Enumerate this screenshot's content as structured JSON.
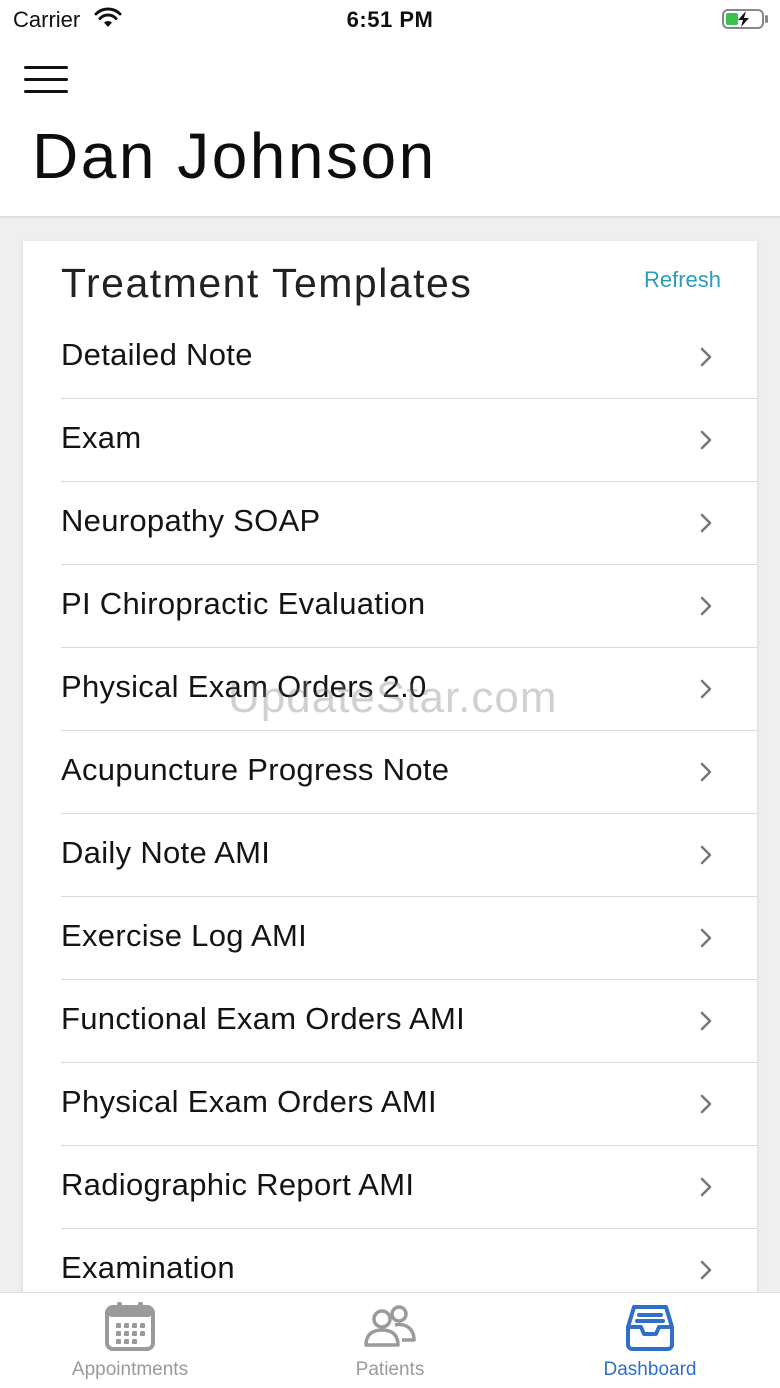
{
  "status_bar": {
    "carrier": "Carrier",
    "time": "6:51 PM"
  },
  "header": {
    "title": "Dan Johnson",
    "menu_icon": "hamburger-menu-icon"
  },
  "card": {
    "title": "Treatment Templates",
    "refresh_label": "Refresh",
    "accent_color": "#2a9dbb",
    "items": [
      {
        "label": "Detailed Note"
      },
      {
        "label": "Exam"
      },
      {
        "label": "Neuropathy SOAP"
      },
      {
        "label": "PI Chiropractic Evaluation"
      },
      {
        "label": "Physical Exam Orders 2.0"
      },
      {
        "label": "Acupuncture Progress Note"
      },
      {
        "label": "Daily Note AMI"
      },
      {
        "label": "Exercise Log AMI"
      },
      {
        "label": "Functional Exam Orders AMI"
      },
      {
        "label": "Physical Exam Orders AMI"
      },
      {
        "label": "Radiographic Report AMI"
      },
      {
        "label": "Examination"
      }
    ]
  },
  "watermark": "UpdateStar.com",
  "tab_bar": {
    "active_color": "#2f6fc9",
    "tabs": [
      {
        "label": "Appointments",
        "icon": "calendar-icon",
        "active": false
      },
      {
        "label": "Patients",
        "icon": "people-icon",
        "active": false
      },
      {
        "label": "Dashboard",
        "icon": "inbox-tray-icon",
        "active": true
      }
    ]
  }
}
